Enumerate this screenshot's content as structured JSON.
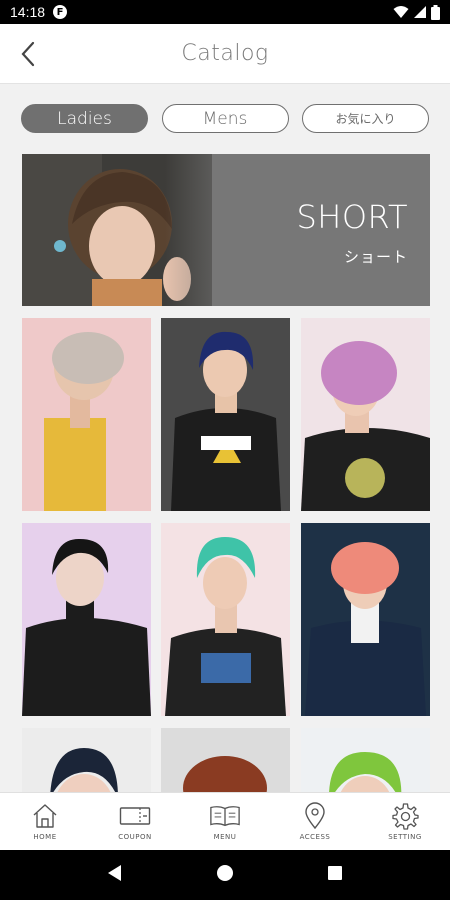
{
  "status_bar": {
    "time": "14:18",
    "app_icon": "F"
  },
  "header": {
    "title": "Catalog",
    "back_icon": "back-arrow-icon"
  },
  "segments": [
    {
      "label": "Ladies",
      "active": true
    },
    {
      "label": "Mens",
      "active": false
    },
    {
      "label": "お気に入り",
      "active": false
    }
  ],
  "banner": {
    "title": "SHORT",
    "subtitle": "ショート"
  },
  "bottom_nav": [
    {
      "label": "HOME",
      "icon": "home-icon"
    },
    {
      "label": "COUPON",
      "icon": "coupon-icon"
    },
    {
      "label": "MENU",
      "icon": "book-icon"
    },
    {
      "label": "ACCESS",
      "icon": "location-pin-icon"
    },
    {
      "label": "SETTING",
      "icon": "gear-icon"
    }
  ],
  "colors": {
    "accent_gray": "#707070",
    "background": "#f1f1f1"
  }
}
